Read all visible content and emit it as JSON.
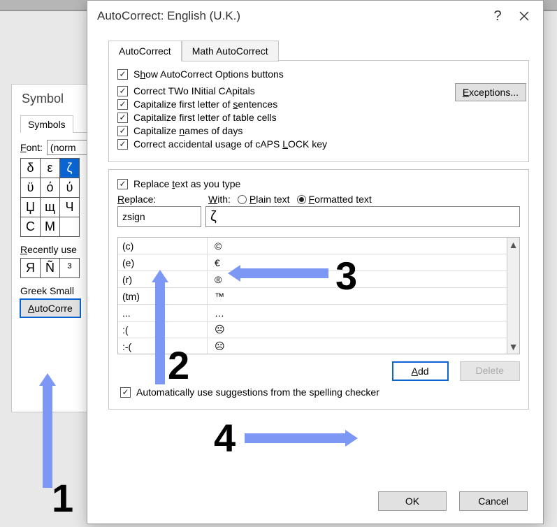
{
  "symbol": {
    "title": "Symbol",
    "tab": "Symbols",
    "font_label": "Font:",
    "font_value": "(norm",
    "grid": [
      [
        "δ",
        "ε",
        "ζ"
      ],
      [
        "ϋ",
        "ό",
        "ύ"
      ],
      [
        "Џ",
        "щ",
        "Ч"
      ],
      [
        "С",
        "М",
        ""
      ]
    ],
    "selected_cell": [
      0,
      2
    ],
    "recent_label": "Recently use",
    "recent": [
      "Я",
      "Ñ",
      "³"
    ],
    "subset_label": "Greek Small",
    "autocorrect_btn": "AutoCorre"
  },
  "autocorrect": {
    "title": "AutoCorrect: English (U.K.)",
    "tabs": {
      "active": "AutoCorrect",
      "inactive": "Math AutoCorrect"
    },
    "options": {
      "show": "Show AutoCorrect Options buttons",
      "two": "Correct TWo INitial CApitals",
      "sent": "Capitalize first letter of sentences",
      "cells": "Capitalize first letter of table cells",
      "days": "Capitalize names of days",
      "caps": "Correct accidental usage of cAPS LOCK key"
    },
    "exceptions": "Exceptions...",
    "replace_chk": "Replace text as you type",
    "replace_lbl": "Replace:",
    "with_lbl": "With:",
    "radio_plain": "Plain text",
    "radio_fmt": "Formatted text",
    "replace_value": "zsign",
    "with_value": "ζ",
    "rows": [
      {
        "r": "(c)",
        "w": "©"
      },
      {
        "r": "(e)",
        "w": "€"
      },
      {
        "r": "(r)",
        "w": "®"
      },
      {
        "r": "(tm)",
        "w": "™"
      },
      {
        "r": "...",
        "w": "…"
      },
      {
        "r": ":(",
        "w": "☹"
      },
      {
        "r": ":-(",
        "w": "☹"
      }
    ],
    "add": "Add",
    "delete": "Delete",
    "auto_sugg": "Automatically use suggestions from the spelling checker",
    "ok": "OK",
    "cancel": "Cancel"
  },
  "annotations": {
    "n1": "1",
    "n2": "2",
    "n3": "3",
    "n4": "4"
  }
}
